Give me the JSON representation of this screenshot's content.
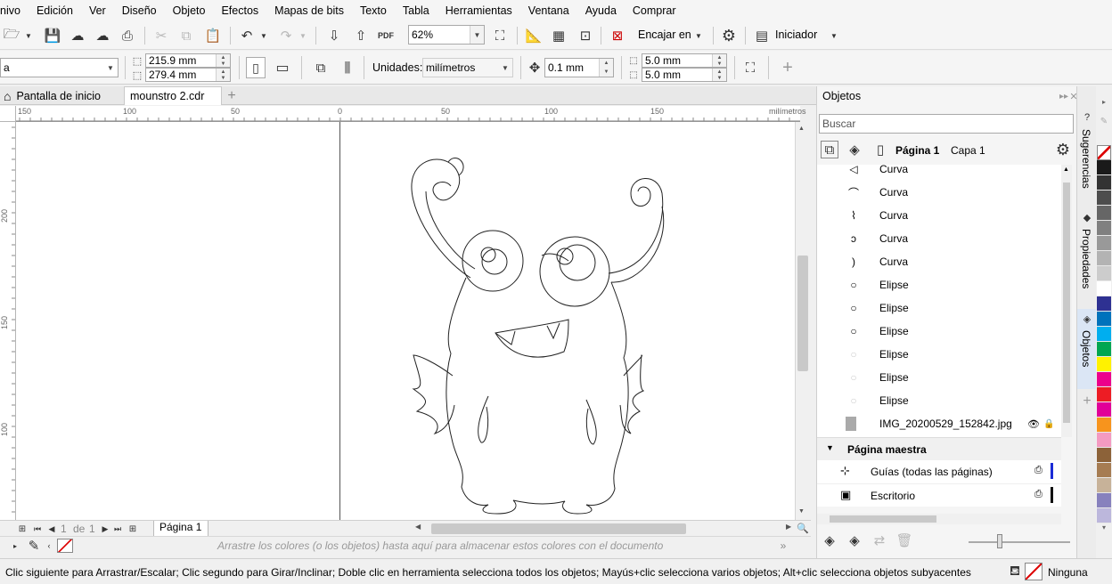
{
  "menu": [
    "nivo",
    "Edición",
    "Ver",
    "Diseño",
    "Objeto",
    "Efectos",
    "Mapas de bits",
    "Texto",
    "Tabla",
    "Herramientas",
    "Ventana",
    "Ayuda",
    "Comprar"
  ],
  "toolbar": {
    "zoom": "62%",
    "snap_label": "Encajar en",
    "launcher_label": "Iniciador",
    "pdf_label": "PDF"
  },
  "propbar": {
    "preset_value": "a",
    "width": "215.9 mm",
    "height": "279.4 mm",
    "units_label": "Unidades:",
    "units_value": "milímetros",
    "nudge": "0.1 mm",
    "dup_x": "5.0 mm",
    "dup_y": "5.0 mm"
  },
  "tabs": {
    "home": "Pantalla de inicio",
    "doc": "mounstro 2.cdr"
  },
  "ruler": {
    "h_ticks": [
      "150",
      "100",
      "50",
      "0",
      "50",
      "100",
      "150"
    ],
    "unit": "milímetros",
    "v_ticks": [
      "200",
      "150",
      "100"
    ]
  },
  "pagebar": {
    "current": "1",
    "of": "de",
    "total": "1",
    "page_tab": "Página 1"
  },
  "colorbar": {
    "hint": "Arrastre los colores (o los objetos) hasta aquí para almacenar estos colores con el documento"
  },
  "status": {
    "hint": "Clic siguiente para Arrastrar/Escalar; Clic segundo para Girar/Inclinar; Doble clic en herramienta selecciona todos los objetos; Mayús+clic selecciona varios objetos; Alt+clic selecciona objetos subyacentes",
    "fill": "Ninguna"
  },
  "docker": {
    "title": "Objetos",
    "search_placeholder": "Buscar",
    "page": "Página 1",
    "layer": "Capa 1",
    "objects": [
      "Curva",
      "Curva",
      "Curva",
      "Curva",
      "Curva",
      "Elipse",
      "Elipse",
      "Elipse",
      "Elipse",
      "Elipse",
      "Elipse",
      "IMG_20200529_152842.jpg"
    ],
    "master": "Página maestra",
    "master_items": [
      "Guías (todas las páginas)",
      "Escritorio"
    ]
  },
  "sidetabs": [
    "Sugerencias",
    "Propiedades",
    "Objetos"
  ],
  "palette_colors": [
    "#ffffff",
    "#1a1a1a",
    "#333333",
    "#4d4d4d",
    "#666666",
    "#808080",
    "#999999",
    "#b3b3b3",
    "#cccccc",
    "#ffffff",
    "#2e3192",
    "#0072bc",
    "#00aeef",
    "#00a651",
    "#fff200",
    "#ec008c",
    "#ed1c24",
    "#e10098",
    "#f7941d",
    "#f49ac1",
    "#8c6239",
    "#a67c52",
    "#c7b299",
    "#8781bd",
    "#bcb7dc"
  ]
}
